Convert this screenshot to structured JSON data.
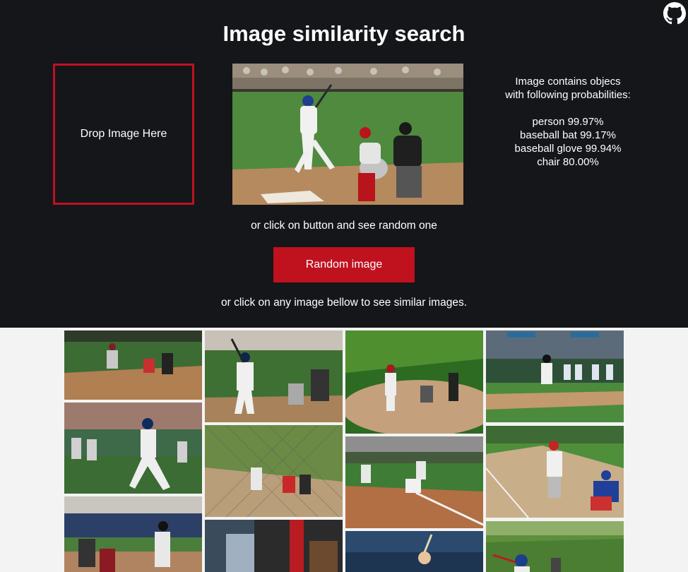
{
  "page": {
    "title": "Image similarity search",
    "drop_label": "Drop Image Here",
    "or_random_text": "or click on button and see random one",
    "random_button_label": "Random image",
    "or_similar_text": "or click on any image bellow to see similar images."
  },
  "probabilities": {
    "heading_line1": "Image contains objecs",
    "heading_line2": "with following probabilities:",
    "items": [
      {
        "label": "person 99.97%"
      },
      {
        "label": "baseball bat 99.17%"
      },
      {
        "label": "baseball glove 99.94%"
      },
      {
        "label": "chair 80.00%"
      }
    ]
  },
  "query_image": {
    "subject": "baseball batter, catcher and umpire at home plate"
  },
  "gallery": {
    "item_count": 14,
    "subject": "baseball batting photos"
  },
  "colors": {
    "accent": "#c0111f",
    "header_bg": "#14161a",
    "page_bg": "#f3f3f3"
  },
  "icons": {
    "github": "github-icon"
  }
}
